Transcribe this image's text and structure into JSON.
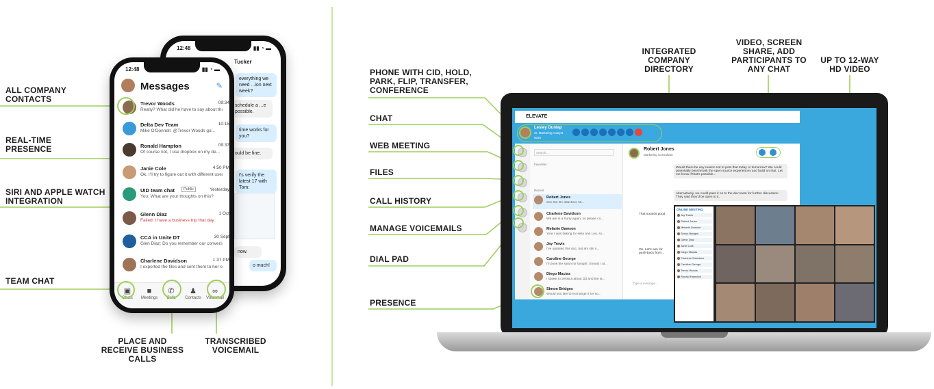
{
  "left_callouts": {
    "all_company_contacts": "ALL COMPANY CONTACTS",
    "real_time_presence": "REAL-TIME PRESENCE",
    "siri_apple_watch": "SIRI AND APPLE WATCH INTEGRATION",
    "team_chat": "TEAM CHAT",
    "place_receive_calls": "PLACE AND RECEIVE BUSINESS CALLS",
    "transcribed_voicemail": "TRANSCRIBED VOICEMAIL"
  },
  "right_callouts": {
    "phone_with_cid": "PHONE WITH CID, HOLD, PARK, FLIP, TRANSFER, CONFERENCE",
    "chat": "CHAT",
    "web_meeting": "WEB MEETING",
    "files": "FILES",
    "call_history": "CALL HISTORY",
    "manage_voicemails": "MANAGE VOICEMAILS",
    "dial_pad": "DIAL PAD",
    "presence": "PRESENCE",
    "integrated_directory": "INTEGRATED COMPANY DIRECTORY",
    "video_screen_share": "VIDEO, SCREEN SHARE, ADD PARTICIPANTS TO ANY CHAT",
    "hd_video": "UP TO 12-WAY HD VIDEO"
  },
  "phone_front": {
    "time": "12:48",
    "title": "Messages",
    "chats": [
      {
        "name": "Trevor Woods",
        "preview": "Really? What did he have to say about that?",
        "time": "09:34"
      },
      {
        "name": "Delta Dev Team",
        "preview": "Mike O'Donnell: @Trevor Woods go...",
        "time": "10:15"
      },
      {
        "name": "Ronald Hampton",
        "preview": "Of course not, I use dropbox on my de...",
        "time": "09:37"
      },
      {
        "name": "Janie Cole",
        "preview": "Ok, I'll try to figure out it with different users",
        "time": "4:50 PM"
      },
      {
        "name": "UID team chat",
        "preview": "You: What are your thoughts on this?",
        "time": "Yesterday"
      },
      {
        "name": "Glenn Diaz",
        "preview": "Failed: I have a business trip that day",
        "time": "1 Oct"
      },
      {
        "name": "CCA in Unite DT",
        "preview": "Glen Diaz: Do you remember our conversatio...",
        "time": "30 Sept"
      },
      {
        "name": "Charlene Davidson",
        "preview": "I exported the files and sent them to her on...",
        "time": "1:37 PM"
      }
    ],
    "tabs": [
      "Chats",
      "Meetings",
      "Calls",
      "Contacts",
      "Voicemail"
    ],
    "public_badge": "Public"
  },
  "phone_back": {
    "time": "12:48",
    "contact": "Tucker",
    "bubbles": [
      "everything we need ...ion next week?",
      "schedule a ...e possible.",
      "time works for you?",
      "ould be fine.",
      "t's verify the latest 17 with Tom:",
      "now.",
      "o much!"
    ]
  },
  "laptop": {
    "brand": "ELEVATE",
    "user_name": "Lesley Dunlap",
    "user_title": "Sr. Marketing Analyst",
    "user_ext": "9025",
    "search_placeholder": "Search...",
    "favorites_label": "Favorites",
    "recent_label": "Recent",
    "contacts": [
      {
        "name": "Robert Jones",
        "preview": "See the file attached, fill..."
      },
      {
        "name": "Charlene Davidson",
        "preview": "We are in a hurry again, so please co..."
      },
      {
        "name": "Melanie Dawson",
        "preview": "Your I was talking to Hella and Lou, so..."
      },
      {
        "name": "Jay Travis",
        "preview": "I've updated this doc, but am still n..."
      },
      {
        "name": "Caroline George",
        "preview": "I'll book the salon for tonight. Should I al..."
      },
      {
        "name": "Diego Macias",
        "preview": "I spoke to Jessica about Q3 and the la..."
      },
      {
        "name": "Simon Bridges",
        "preview": "Would you like to exchange it for so..."
      }
    ],
    "conversation_name": "Robert Jones",
    "conversation_title": "Marketing Consultant",
    "messages": [
      "Would there be any reason not to post that today or tomorrow? We could potentially benchmark the open source experiences and build on that. Let me know if that's possible...",
      "Alternatively, we could pass it on to the dev team for further discussion. They said they'd be open to it.",
      "That sounds good",
      "Ok. Let's aim for push-back from..."
    ],
    "composer_placeholder": "Type a message...",
    "meeting_title": "ONLINE MEETING",
    "meeting_participants": [
      "Jay Travis",
      "Robert Jones",
      "Melanie Dawson",
      "Simon Bridges",
      "Glenn Diaz",
      "Janie Cole",
      "Diego Macias",
      "Charlene Davidson",
      "Caroline George",
      "Trevor Woods",
      "Ronald Hampton"
    ]
  },
  "colors": {
    "accent_green": "#9dcf5b",
    "app_blue": "#39a9e0",
    "call_red": "#e6463c"
  }
}
